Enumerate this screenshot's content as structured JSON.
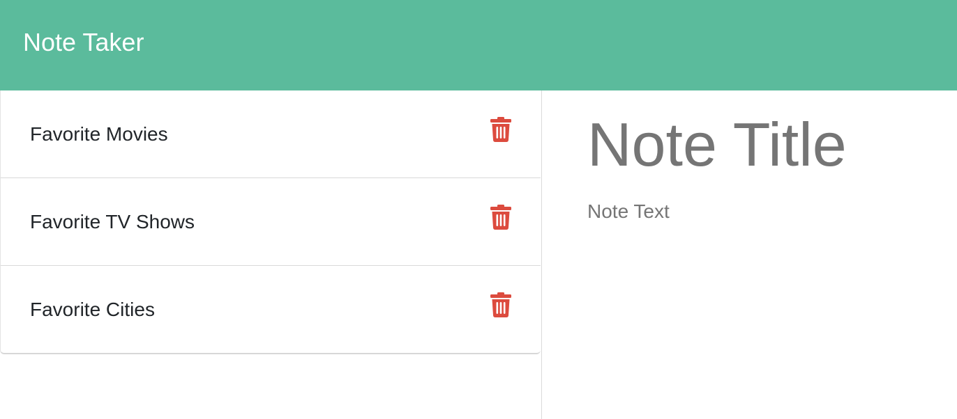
{
  "navbar": {
    "brand": "Note Taker",
    "background_color": "#5bbb9c"
  },
  "notes": [
    {
      "label": "Favorite Movies",
      "icon": "trash-icon"
    },
    {
      "label": "Favorite TV Shows",
      "icon": "trash-icon"
    },
    {
      "label": "Favorite Cities",
      "icon": "trash-icon"
    }
  ],
  "editor": {
    "title_placeholder": "Note Title",
    "title_value": "",
    "text_placeholder": "Note Text",
    "text_value": ""
  },
  "colors": {
    "accent": "#5bbb9c",
    "delete": "#dc4b3e",
    "placeholder": "#757575"
  }
}
